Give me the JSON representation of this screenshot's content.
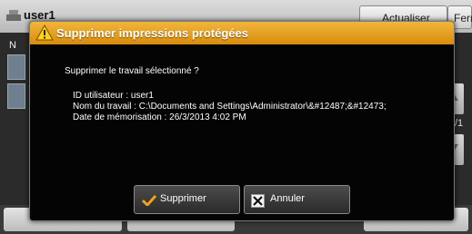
{
  "background": {
    "user_name": "user1",
    "refresh_label": "Actualiser",
    "close_label": "Fermer",
    "side_label": "N",
    "page_indicator": "/1"
  },
  "dialog": {
    "title": "Supprimer impressions protégées",
    "question": "Supprimer le travail sélectionné ?",
    "user_id_line": "ID utilisateur : user1",
    "job_name_line": "Nom du travail : C:\\Documents and Settings\\Administrator\\&#12487;&#12473;",
    "date_line": "Date de mémorisation : 26/3/2013 4:02 PM",
    "delete_label": "Supprimer",
    "cancel_label": "Annuler"
  },
  "colors": {
    "header_orange": "#e8a020",
    "dialog_bg": "#050505",
    "check_orange": "#f2a21a"
  },
  "icons": {
    "warning": "warning-icon",
    "delete": "check-icon",
    "cancel": "x-icon"
  }
}
